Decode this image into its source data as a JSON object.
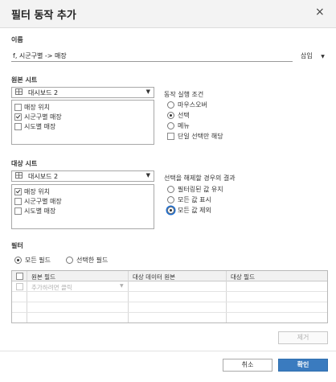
{
  "dialog": {
    "title": "필터 동작 추가",
    "close_glyph": "×"
  },
  "name_section": {
    "label": "이름",
    "value": "f, 시군구별 -> 매장",
    "insert_label": "삽입",
    "insert_caret": "▼"
  },
  "source_sheet": {
    "label": "원본 시트",
    "dropdown_value": "대시보드 2",
    "items": [
      {
        "label": "매장 위치",
        "checked": false
      },
      {
        "label": "시군구별 매장",
        "checked": true
      },
      {
        "label": "시도별 매장",
        "checked": false
      }
    ]
  },
  "run_action": {
    "label": "동작 실행 조건",
    "options": [
      {
        "label": "마우스오버",
        "selected": false
      },
      {
        "label": "선택",
        "selected": true
      },
      {
        "label": "메뉴",
        "selected": false
      }
    ],
    "single_select_label": "단일 선택만 해당"
  },
  "target_sheet": {
    "label": "대상 시트",
    "dropdown_value": "대시보드 2",
    "items": [
      {
        "label": "매장 위치",
        "checked": true
      },
      {
        "label": "시군구별 매장",
        "checked": false
      },
      {
        "label": "시도별 매장",
        "checked": false
      }
    ]
  },
  "clear_result": {
    "label": "선택을 해제할 경우의 결과",
    "options": [
      {
        "label": "필터링된 값 유지",
        "selected": false
      },
      {
        "label": "모든 값 표시",
        "selected": false
      },
      {
        "label": "모든 값 제외",
        "selected": true
      }
    ]
  },
  "filter_section": {
    "label": "필터",
    "options": [
      {
        "label": "모든 필드",
        "selected": true
      },
      {
        "label": "선택한 필드",
        "selected": false
      }
    ],
    "columns": [
      "원본 필드",
      "대상 데이터 원본",
      "대상 필드"
    ],
    "add_placeholder": "추가하려면 클릭"
  },
  "buttons": {
    "remove": "제거",
    "cancel": "취소",
    "ok": "확인"
  },
  "colors": {
    "accent": "#3a7bbf",
    "focus": "#1f6fd1"
  }
}
